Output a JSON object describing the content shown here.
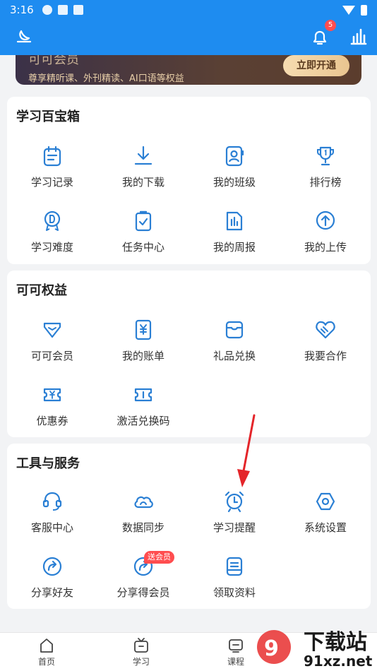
{
  "status_bar": {
    "time": "3:16"
  },
  "header": {
    "notification_count": "5"
  },
  "vip_banner": {
    "title": "可可会员",
    "subtitle": "尊享精听课、外刊精读、AI口语等权益",
    "button_label": "立即开通"
  },
  "sections": {
    "toolbox": {
      "title": "学习百宝箱",
      "items": [
        {
          "label": "学习记录",
          "icon": "calendar-note-icon"
        },
        {
          "label": "我的下载",
          "icon": "download-icon"
        },
        {
          "label": "我的班级",
          "icon": "class-profile-icon"
        },
        {
          "label": "排行榜",
          "icon": "trophy-icon"
        },
        {
          "label": "学习难度",
          "icon": "difficulty-medal-icon"
        },
        {
          "label": "任务中心",
          "icon": "clipboard-check-icon"
        },
        {
          "label": "我的周报",
          "icon": "report-chart-icon"
        },
        {
          "label": "我的上传",
          "icon": "upload-icon"
        }
      ]
    },
    "benefits": {
      "title": "可可权益",
      "items": [
        {
          "label": "可可会员",
          "icon": "vip-diamond-icon"
        },
        {
          "label": "我的账单",
          "icon": "bill-icon"
        },
        {
          "label": "礼品兑换",
          "icon": "gift-box-icon"
        },
        {
          "label": "我要合作",
          "icon": "handshake-heart-icon"
        },
        {
          "label": "优惠券",
          "icon": "coupon-icon"
        },
        {
          "label": "激活兑换码",
          "icon": "ticket-code-icon"
        }
      ]
    },
    "services": {
      "title": "工具与服务",
      "items": [
        {
          "label": "客服中心",
          "icon": "headset-icon"
        },
        {
          "label": "数据同步",
          "icon": "cloud-sync-icon"
        },
        {
          "label": "学习提醒",
          "icon": "alarm-clock-icon"
        },
        {
          "label": "系统设置",
          "icon": "settings-hexagon-icon"
        },
        {
          "label": "分享好友",
          "icon": "share-icon"
        },
        {
          "label": "分享得会员",
          "icon": "share-vip-icon"
        },
        {
          "label": "领取资料",
          "icon": "materials-icon"
        }
      ],
      "promo_tag": "送会员"
    }
  },
  "tab_bar": {
    "tabs": [
      {
        "label": "首页",
        "icon": "home-icon"
      },
      {
        "label": "学习",
        "icon": "study-tv-icon"
      },
      {
        "label": "课程",
        "icon": "course-icon"
      }
    ]
  },
  "watermark": {
    "text_top": "下载站",
    "text_bottom": "91xz.net"
  },
  "colors": {
    "brand_blue": "#1e8cf0",
    "icon_blue": "#2a7fd4",
    "arrow_red": "#e4252a",
    "badge_red": "#ff4d4f"
  }
}
